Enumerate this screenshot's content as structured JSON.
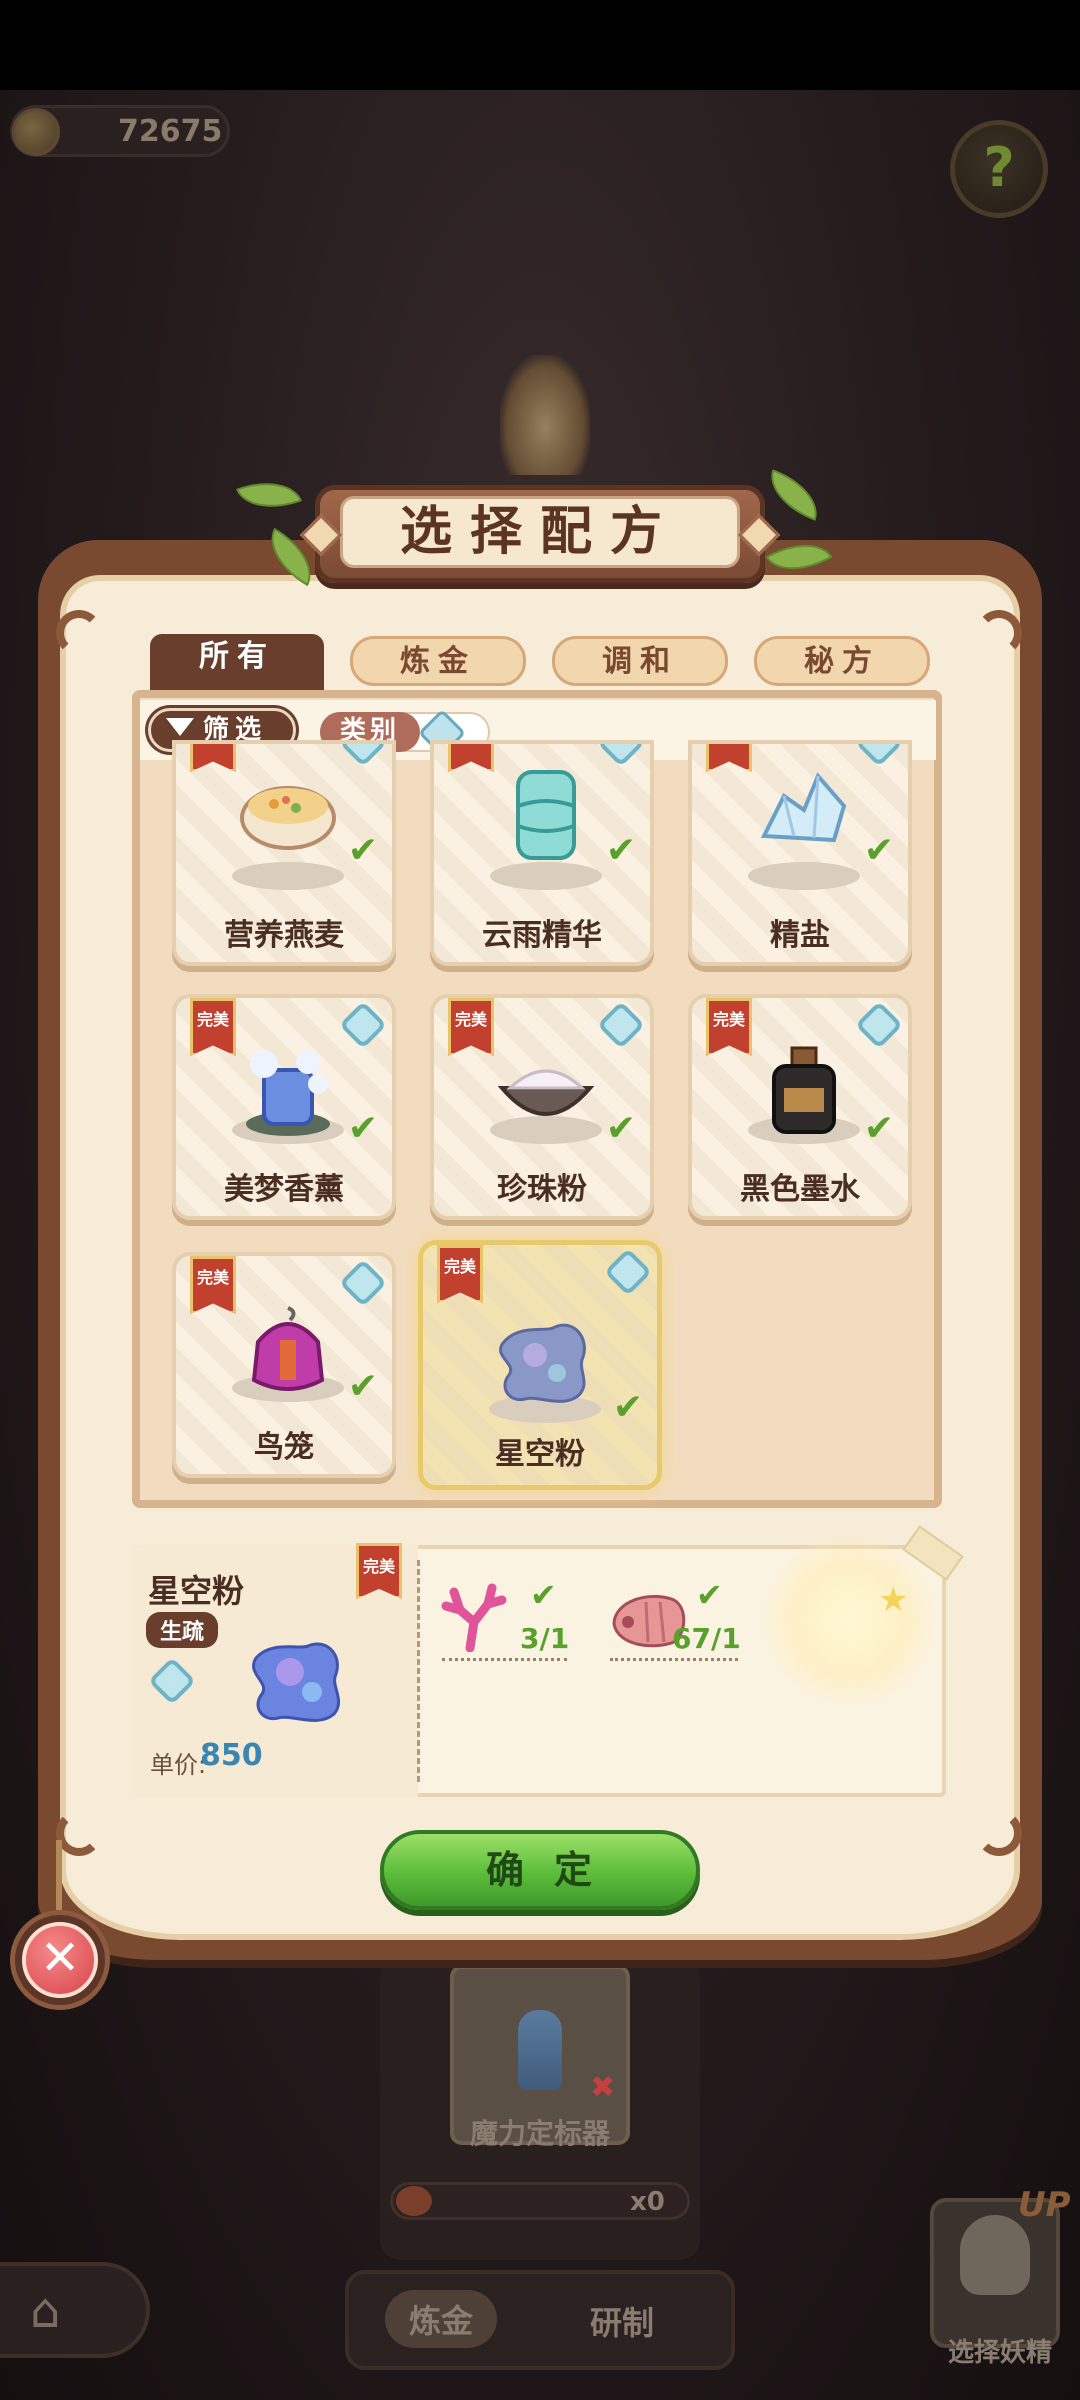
{
  "hud": {
    "coins": "72675",
    "help_icon": "question-icon"
  },
  "dialog": {
    "title": "选择配方",
    "tabs": [
      {
        "label": "所有",
        "active": true
      },
      {
        "label": "炼金",
        "active": false
      },
      {
        "label": "调和",
        "active": false
      },
      {
        "label": "秘方",
        "active": false
      }
    ],
    "filter_label": "筛选",
    "category_label": "类别",
    "recipes": [
      {
        "name": "营养燕麦",
        "badge": "完美",
        "done": true,
        "selected": false,
        "icon": "oatmeal-bowl-icon"
      },
      {
        "name": "云雨精华",
        "badge": "完美",
        "done": true,
        "selected": false,
        "icon": "teal-jar-icon"
      },
      {
        "name": "精盐",
        "badge": "完美",
        "done": true,
        "selected": false,
        "icon": "salt-crystal-icon"
      },
      {
        "name": "美梦香薰",
        "badge": "完美",
        "done": true,
        "selected": false,
        "icon": "aroma-candle-icon"
      },
      {
        "name": "珍珠粉",
        "badge": "完美",
        "done": true,
        "selected": false,
        "icon": "pearl-powder-icon"
      },
      {
        "name": "黑色墨水",
        "badge": "完美",
        "done": true,
        "selected": false,
        "icon": "ink-bottle-icon"
      },
      {
        "name": "鸟笼",
        "badge": "完美",
        "done": true,
        "selected": false,
        "icon": "birdcage-icon"
      },
      {
        "name": "星空粉",
        "badge": "完美",
        "done": false,
        "selected": true,
        "icon": "starry-powder-icon"
      }
    ],
    "detail": {
      "name": "星空粉",
      "badge": "完美",
      "status": "生疏",
      "price_label": "单价:",
      "price": "850",
      "ingredients": [
        {
          "icon": "coral-icon",
          "count": "3/1",
          "done": true
        },
        {
          "icon": "shell-icon",
          "count": "67/1",
          "done": true
        }
      ]
    },
    "confirm_label": "确定"
  },
  "background": {
    "station_label": "魔力定标器",
    "station_count": "x0",
    "bottom_tabs": [
      "炼金",
      "研制"
    ],
    "fairy_label": "选择妖精",
    "fairy_badge": "UP"
  },
  "colors": {
    "frame": "#7a4a30",
    "parchment": "#f7ecd8",
    "confirm_green": "#5cbc3a",
    "check_green": "#5aa02c",
    "ribbon_red": "#c2402e",
    "price_blue": "#3a86b0"
  }
}
